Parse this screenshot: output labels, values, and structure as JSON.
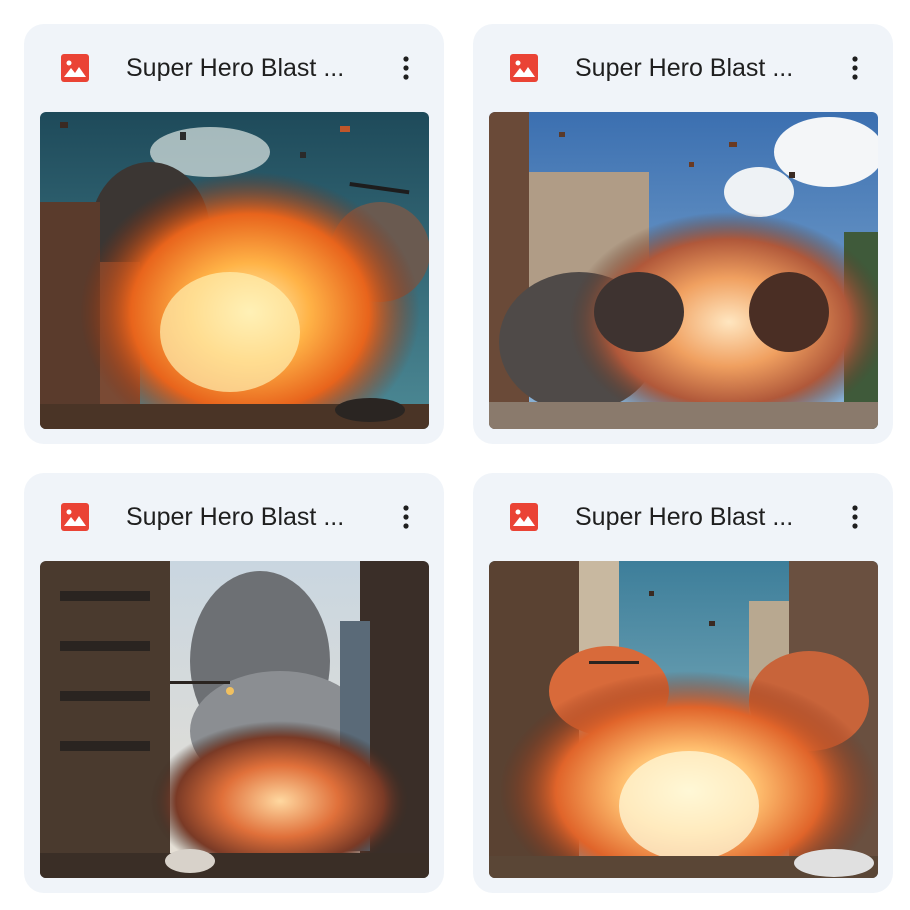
{
  "files": [
    {
      "name": "Super Hero Blast ...",
      "icon": "image-file-icon",
      "menu_icon": "more-vert-icon",
      "thumbnail": "explosion-city-street-1"
    },
    {
      "name": "Super Hero Blast ...",
      "icon": "image-file-icon",
      "menu_icon": "more-vert-icon",
      "thumbnail": "explosion-city-street-2"
    },
    {
      "name": "Super Hero Blast ...",
      "icon": "image-file-icon",
      "menu_icon": "more-vert-icon",
      "thumbnail": "explosion-city-street-3"
    },
    {
      "name": "Super Hero Blast ...",
      "icon": "image-file-icon",
      "menu_icon": "more-vert-icon",
      "thumbnail": "explosion-city-street-4"
    }
  ],
  "colors": {
    "card_bg": "#f0f4f9",
    "icon_red": "#ea4335",
    "text": "#1f1f1f"
  }
}
